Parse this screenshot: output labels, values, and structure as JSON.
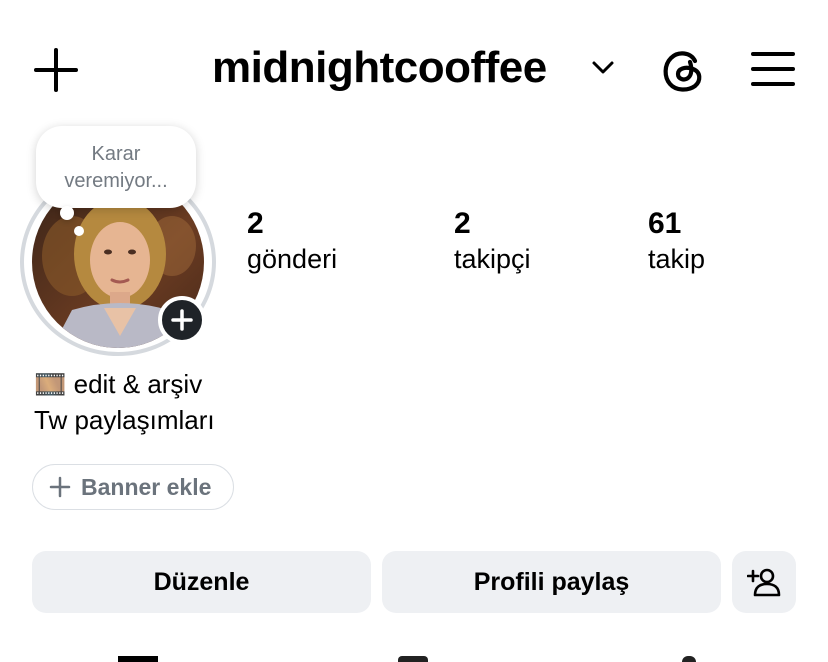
{
  "header": {
    "username": "midnightcooffee",
    "create_icon": "plus-icon",
    "threads_icon": "threads-icon",
    "menu_icon": "hamburger-menu-icon"
  },
  "note": {
    "text_line1": "Karar",
    "text_line2": "veremiyor..."
  },
  "stats": [
    {
      "value": "2",
      "label": "gönderi"
    },
    {
      "value": "2",
      "label": "takipçi"
    },
    {
      "value": "61",
      "label": "takip"
    }
  ],
  "bio": {
    "line1_emoji": "🎞️",
    "line1_text": "edit & arşiv",
    "line2": "Tw paylaşımları"
  },
  "banner_button": {
    "label": "Banner ekle"
  },
  "actions": {
    "edit_label": "Düzenle",
    "share_label": "Profili paylaş",
    "add_person_icon": "add-person-icon"
  },
  "colors": {
    "button_bg": "#eef0f3",
    "ring": "#d5d9de",
    "muted_text": "#6b737c"
  }
}
